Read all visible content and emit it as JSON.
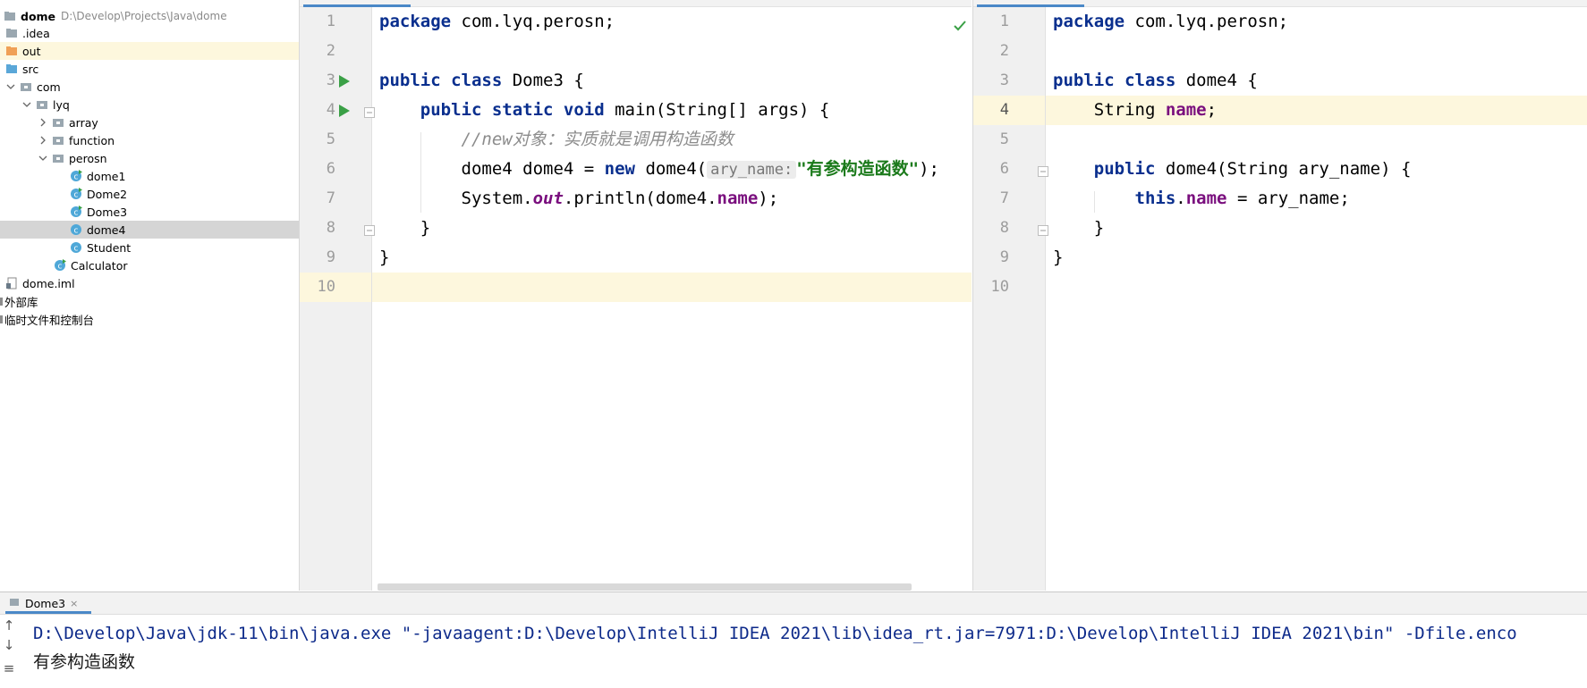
{
  "project": {
    "root_name": "dome",
    "root_path": "D:\\Develop\\Projects\\Java\\dome",
    "items": [
      {
        "label": "dome",
        "kind": "root"
      },
      {
        "label": ".idea",
        "kind": "folder"
      },
      {
        "label": "out",
        "kind": "folder-orange"
      },
      {
        "label": "src",
        "kind": "folder-blue"
      },
      {
        "label": "com",
        "kind": "package"
      },
      {
        "label": "lyq",
        "kind": "package"
      },
      {
        "label": "array",
        "kind": "package"
      },
      {
        "label": "function",
        "kind": "package"
      },
      {
        "label": "perosn",
        "kind": "package"
      },
      {
        "label": "dome1",
        "kind": "class-run"
      },
      {
        "label": "Dome2",
        "kind": "class-run"
      },
      {
        "label": "Dome3",
        "kind": "class-run"
      },
      {
        "label": "dome4",
        "kind": "class"
      },
      {
        "label": "Student",
        "kind": "class"
      },
      {
        "label": "Calculator",
        "kind": "class-run"
      },
      {
        "label": "dome.iml",
        "kind": "file"
      },
      {
        "label": "外部库",
        "kind": "library"
      },
      {
        "label": "临时文件和控制台",
        "kind": "scratch"
      }
    ]
  },
  "editor_left": {
    "line_numbers": [
      "1",
      "2",
      "3",
      "4",
      "5",
      "6",
      "7",
      "8",
      "9",
      "10"
    ],
    "code": {
      "l1_kw": "package",
      "l1_rest": " com.lyq.perosn;",
      "l3_kw": "public class",
      "l3_rest": " Dome3 {",
      "l4_kw": "public static void",
      "l4_rest": " main(String[] args) {",
      "l5_comment": "//new对象：实质就是调用构造函数",
      "l6_a": "dome4 dome4 = ",
      "l6_kw": "new",
      "l6_b": " dome4(",
      "l6_hint": "ary_name:",
      "l6_str": "\"有参构造函数\"",
      "l6_c": ");",
      "l7_a": "System.",
      "l7_static": "out",
      "l7_b": ".println(dome4.",
      "l7_field": "name",
      "l7_c": ");",
      "l8": "}",
      "l9": "}"
    }
  },
  "editor_right": {
    "line_numbers": [
      "1",
      "2",
      "3",
      "4",
      "5",
      "6",
      "7",
      "8",
      "9",
      "10"
    ],
    "code": {
      "l1_kw": "package",
      "l1_rest": " com.lyq.perosn;",
      "l3_kw": "public class",
      "l3_rest": " dome4 {",
      "l4_a": "String ",
      "l4_field": "name",
      "l4_b": ";",
      "l6_kw": "public",
      "l6_rest": " dome4(String ary_name) {",
      "l7_kw": "this",
      "l7_a": ".",
      "l7_field": "name",
      "l7_b": " = ary_name;",
      "l8": "}",
      "l9": "}"
    }
  },
  "run_panel": {
    "tab_label": "Dome3",
    "tab_close": "×",
    "command": "D:\\Develop\\Java\\jdk-11\\bin\\java.exe \"-javaagent:D:\\Develop\\IntelliJ IDEA 2021\\lib\\idea_rt.jar=7971:D:\\Develop\\IntelliJ IDEA 2021\\bin\" -Dfile.enco",
    "output": "有参构造函数"
  },
  "colors": {
    "keyword": "#0a2f8e",
    "field": "#7a0f7e",
    "string": "#1b7a1b",
    "comment": "#8c8c8c",
    "line_highlight": "#fdf7dd",
    "selection": "#d5d5d5"
  }
}
